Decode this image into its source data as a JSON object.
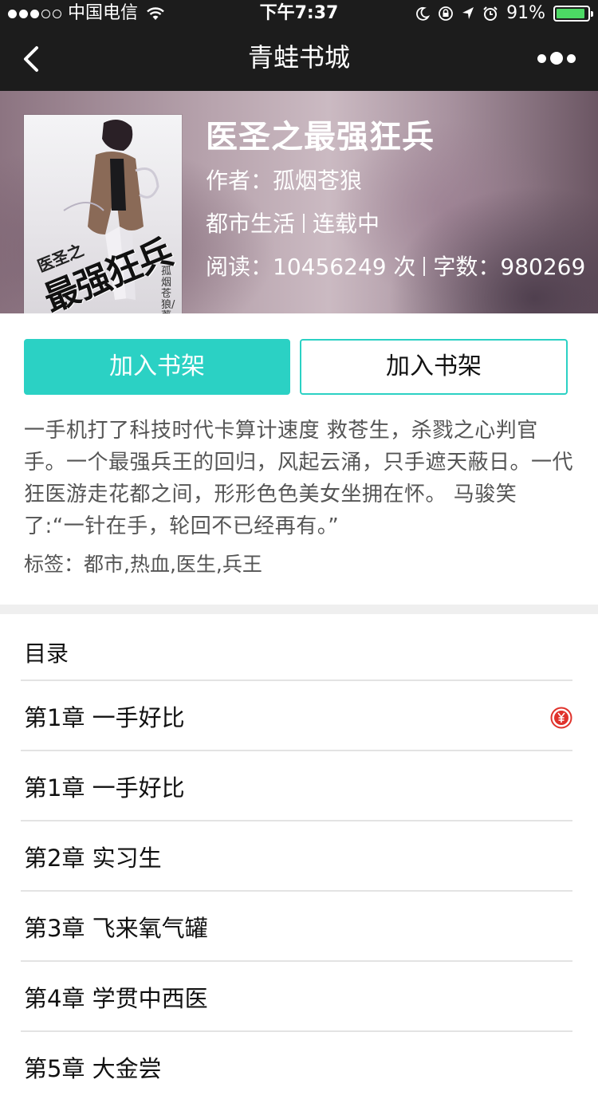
{
  "status_bar": {
    "carrier": "中国电信",
    "time": "下午7:37",
    "battery": "91%",
    "battery_level": 0.91,
    "signal_strength": 3,
    "signal_max": 5
  },
  "nav": {
    "title": "青蛙书城"
  },
  "book": {
    "title": "医圣之最强狂兵",
    "author_line": "作者：孤烟苍狼",
    "category": "都市生活",
    "status": "连载中",
    "reads": "阅读：10456249 次",
    "word_count": "字数：980269",
    "cover": {
      "subtitle": "医圣之",
      "title": "最强狂兵",
      "author": "孤烟苍狼/著"
    }
  },
  "actions": {
    "primary_label": "加入书架",
    "secondary_label": "加入书架"
  },
  "description": "一手机打了科技时代卡算计速度 救苍生，杀戮之心判官手。一个最强兵王的回归，风起云涌，只手遮天蔽日。一代狂医游走花都之间，形形色色美女坐拥在怀。 马骏笑了:“一针在手，轮回不已经再有。”",
  "tags": "标签：都市,热血,医生,兵王",
  "catalog": {
    "heading": "目录",
    "chapters": [
      {
        "title": "第1章  一手好比",
        "paid": true
      },
      {
        "title": "第1章  一手好比",
        "paid": false
      },
      {
        "title": "第2章  实习生",
        "paid": false
      },
      {
        "title": "第3章  飞来氧气罐",
        "paid": false
      },
      {
        "title": "第4章  学贯中西医",
        "paid": false
      },
      {
        "title": "第5章  大金尝",
        "paid": false
      }
    ]
  },
  "colors": {
    "accent": "#2bd1c4",
    "paid_icon": "#e0322b",
    "top_bar": "#1c1c1c"
  }
}
